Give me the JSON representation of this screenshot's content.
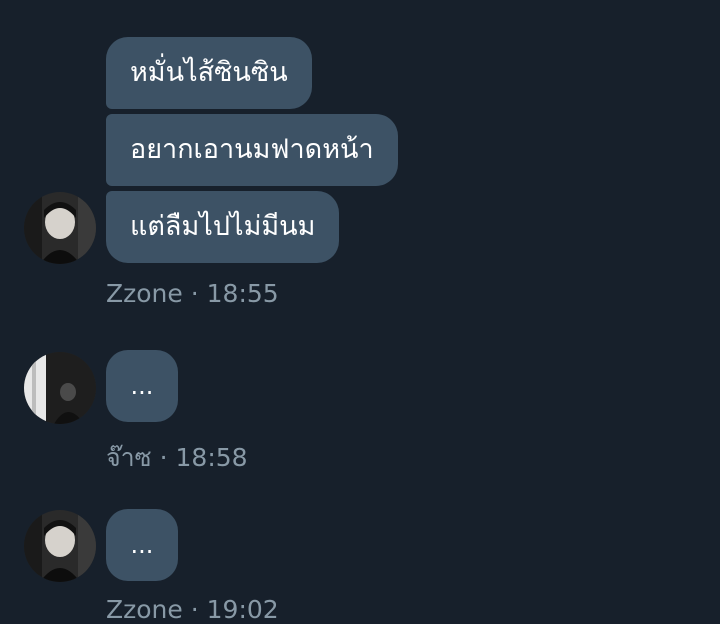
{
  "groups": [
    {
      "sender": "Zzone",
      "time": "18:55",
      "separator": "·",
      "messages": [
        "หมั่นไส้ซินซิน",
        "อยากเอานมฟาดหน้า",
        "แต่ลืมไปไม่มีนม"
      ]
    },
    {
      "sender": "จ๊าซ",
      "time": "18:58",
      "separator": "·",
      "messages": [
        "..."
      ]
    },
    {
      "sender": "Zzone",
      "time": "19:02",
      "separator": "·",
      "messages": [
        "..."
      ]
    }
  ],
  "colors": {
    "background": "#17202b",
    "bubble": "#3d5265",
    "meta_text": "#8899a6"
  }
}
